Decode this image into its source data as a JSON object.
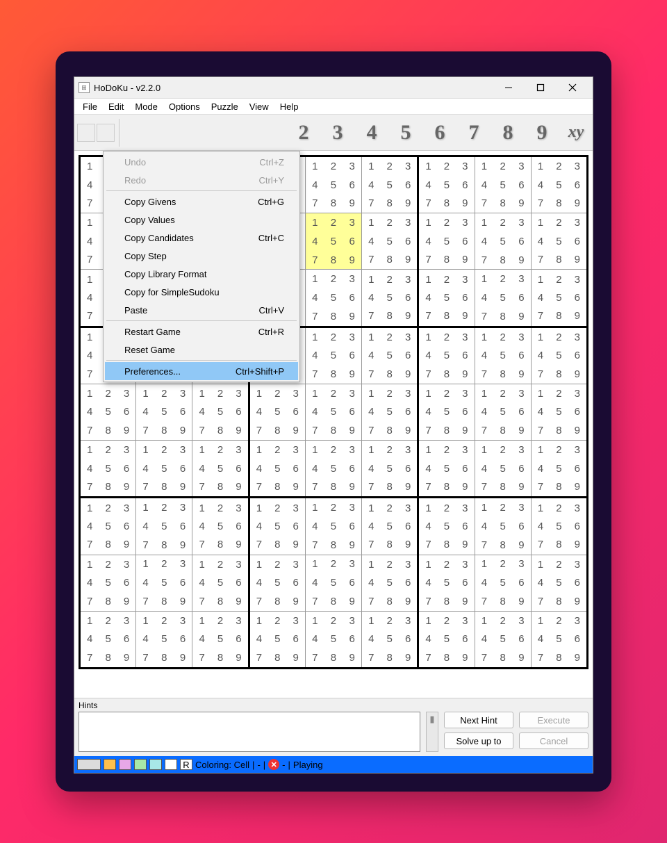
{
  "title": "HoDoKu - v2.2.0",
  "menubar": [
    "File",
    "Edit",
    "Mode",
    "Options",
    "Puzzle",
    "View",
    "Help"
  ],
  "num_picker": [
    "2",
    "3",
    "4",
    "5",
    "6",
    "7",
    "8",
    "9"
  ],
  "num_picker_xy": "xy",
  "dropdown": {
    "items": [
      {
        "label": "Undo",
        "accel": "Ctrl+Z",
        "dim": true
      },
      {
        "label": "Redo",
        "accel": "Ctrl+Y",
        "dim": true
      },
      {
        "sep": true
      },
      {
        "label": "Copy Givens",
        "accel": "Ctrl+G"
      },
      {
        "label": "Copy Values",
        "accel": ""
      },
      {
        "label": "Copy Candidates",
        "accel": "Ctrl+C"
      },
      {
        "label": "Copy Step",
        "accel": ""
      },
      {
        "label": "Copy Library Format",
        "accel": ""
      },
      {
        "label": "Copy for SimpleSudoku",
        "accel": ""
      },
      {
        "label": "Paste",
        "accel": "Ctrl+V"
      },
      {
        "sep": true
      },
      {
        "label": "Restart Game",
        "accel": "Ctrl+R"
      },
      {
        "label": "Reset Game",
        "accel": ""
      },
      {
        "sep": true
      },
      {
        "label": "Preferences...",
        "accel": "Ctrl+Shift+P",
        "selected": true
      }
    ]
  },
  "grid": {
    "highlight_cell": {
      "r": 1,
      "c": 4
    },
    "candidates": [
      1,
      2,
      3,
      4,
      5,
      6,
      7,
      8,
      9
    ]
  },
  "hints": {
    "label": "Hints",
    "buttons": {
      "next_hint": "Next Hint",
      "execute": "Execute",
      "solve_up_to": "Solve up to",
      "cancel": "Cancel"
    }
  },
  "status": {
    "r_label": "R",
    "coloring": "Coloring: Cell",
    "sep": "|",
    "dash": "-",
    "playing": "Playing",
    "swatches": [
      "#dcdcdc",
      "#ffc04d",
      "#e8a8e8",
      "#a8e8a8",
      "#a8e8e8",
      "#ffffff"
    ]
  }
}
